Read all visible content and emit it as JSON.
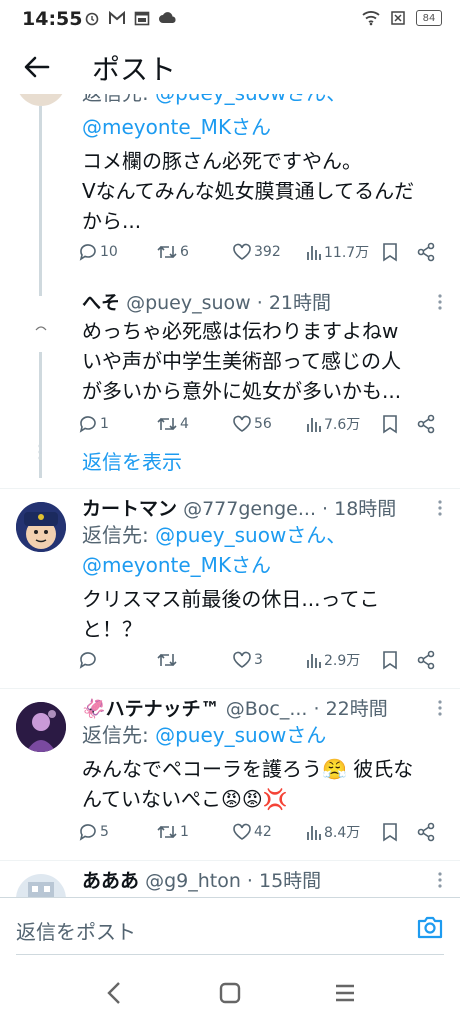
{
  "status_bar": {
    "time": "14:55",
    "battery": "84"
  },
  "header": {
    "title": "ポスト"
  },
  "tweets": [
    {
      "reply_to_prefix": "返信先: ",
      "reply_to_line1": "@puey_suowさん、",
      "reply_to_line2": "@meyonte_MKさん",
      "text_lines": [
        "コメ欄の豚さん必死ですやん。",
        "Vなんてみんな処女膜貫通してるんだ",
        "から..."
      ],
      "replies": "10",
      "retweets": "6",
      "likes": "392",
      "views": "11.7万"
    },
    {
      "name": "へそ",
      "handle": "@puey_suow",
      "time": "· 21時間",
      "text_lines": [
        "めっちゃ必死感は伝わりますよねw",
        "いや声が中学生美術部って感じの人",
        "が多いから意外に処女が多いかも..."
      ],
      "replies": "1",
      "retweets": "4",
      "likes": "56",
      "views": "7.6万",
      "show_replies": "返信を表示"
    },
    {
      "name": "カートマン",
      "handle": "@777genge...",
      "time": "· 18時間",
      "reply_to_prefix": "返信先: ",
      "reply_to_line1": "@puey_suowさん、",
      "reply_to_line2": "@meyonte_MKさん",
      "text_lines": [
        "クリスマス前最後の休日...ってこ",
        "と！？"
      ],
      "replies": "",
      "retweets": "",
      "likes": "3",
      "views": "2.9万"
    },
    {
      "name": "ハテナッチ™",
      "name_emoji": "🦑",
      "handle": "@Boc_...",
      "time": "· 22時間",
      "reply_to_prefix": "返信先: ",
      "reply_to_line1": "@puey_suowさん",
      "text_lines": [
        "みんなでペコーラを護ろう😤 彼氏な",
        "んていないぺこ😡😡💢"
      ],
      "replies": "5",
      "retweets": "1",
      "likes": "42",
      "views": "8.4万"
    },
    {
      "name": "あああ",
      "handle": "@g9_hton",
      "time": "· 15時間"
    }
  ],
  "reply_bar": {
    "placeholder": "返信をポスト"
  },
  "colors": {
    "accent": "#1d9bf0",
    "secondary_text": "#536471",
    "primary_text": "#0f1419",
    "divider": "#eff3f4"
  }
}
